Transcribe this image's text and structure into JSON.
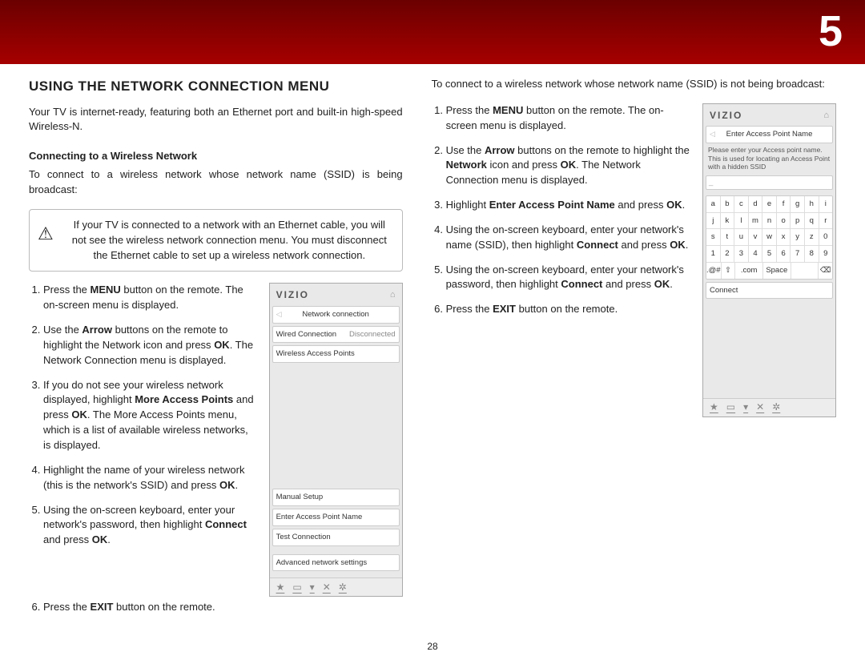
{
  "chapter_number": "5",
  "page_number": "28",
  "section_heading": "USING THE NETWORK CONNECTION MENU",
  "intro": "Your TV is internet-ready, featuring both an Ethernet port and built-in high-speed Wireless-N.",
  "subhead_a": "Connecting to a Wireless Network",
  "lead_a": "To connect to a wireless network whose network name (SSID) is being broadcast:",
  "callout": {
    "icon": "⚠",
    "text": "If your TV is connected to a network with an Ethernet cable, you will not see the wireless network connection menu. You must disconnect the Ethernet cable to set up a wireless network connection."
  },
  "steps_a": [
    {
      "pre": "Press the ",
      "b": "MENU",
      "post": " button on the remote. The on-screen menu is displayed."
    },
    {
      "pre": "Use the ",
      "b": "Arrow",
      "mid": " buttons on the remote to highlight the Network icon and press ",
      "b2": "OK",
      "post": ". The Network Connection menu is displayed."
    },
    {
      "pre": "If you do not see your wireless network displayed, highlight ",
      "b": "More Access Points",
      "mid": " and press ",
      "b2": "OK",
      "post": ". The More Access Points menu, which is a list of available wireless networks, is displayed."
    },
    {
      "pre": "Highlight the name of your wireless network (this is the network's SSID) and press ",
      "b": "OK",
      "post": "."
    },
    {
      "pre": "Using the on-screen keyboard, enter your network's password, then highlight ",
      "b": "Connect",
      "mid": " and press ",
      "b2": "OK",
      "post": "."
    },
    {
      "pre": "Press the ",
      "b": "EXIT",
      "post": " button on the remote."
    }
  ],
  "panel_a": {
    "brand": "VIZIO",
    "home_icon": "⌂",
    "crumb": "Network connection",
    "back_icon": "◁",
    "rows": [
      {
        "label": "Wired Connection",
        "value": "Disconnected"
      },
      {
        "label": "Wireless Access Points",
        "value": ""
      }
    ],
    "options": [
      "Manual Setup",
      "Enter Access Point Name",
      "Test Connection"
    ],
    "advanced": "Advanced network settings",
    "foot_icons": [
      "★",
      "▭",
      "▾",
      "✕",
      "✲"
    ]
  },
  "lead_b": "To connect to a wireless network whose network name (SSID) is not being broadcast:",
  "steps_b": [
    {
      "pre": "Press the ",
      "b": "MENU",
      "post": " button on the remote. The on-screen menu is displayed."
    },
    {
      "pre": "Use the ",
      "b": "Arrow",
      "mid": " buttons on the remote to highlight the ",
      "b2": "Network",
      "mid2": " icon and press ",
      "b3": "OK",
      "post": ". The Network Connection menu is displayed."
    },
    {
      "pre": "Highlight ",
      "b": "Enter Access Point Name",
      "mid": " and press ",
      "b2": "OK",
      "post": "."
    },
    {
      "pre": "Using the on-screen keyboard, enter your network's name (SSID), then highlight ",
      "b": "Connect",
      "mid": " and press ",
      "b2": "OK",
      "post": "."
    },
    {
      "pre": "Using the on-screen keyboard, enter your network's password, then highlight ",
      "b": "Connect",
      "mid": " and press ",
      "b2": "OK",
      "post": "."
    },
    {
      "pre": "Press the ",
      "b": "EXIT",
      "post": " button on the remote."
    }
  ],
  "panel_b": {
    "brand": "VIZIO",
    "home_icon": "⌂",
    "crumb": "Enter Access Point Name",
    "back_icon": "◁",
    "desc": "Please enter your Access point name. This is used for locating an Access Point with a hidden SSID",
    "caret": "_",
    "keyboard": [
      [
        "a",
        "b",
        "c",
        "d",
        "e",
        "f",
        "g",
        "h",
        "i"
      ],
      [
        "j",
        "k",
        "l",
        "m",
        "n",
        "o",
        "p",
        "q",
        "r"
      ],
      [
        "s",
        "t",
        "u",
        "v",
        "w",
        "x",
        "y",
        "z",
        "0"
      ],
      [
        "1",
        "2",
        "3",
        "4",
        "5",
        "6",
        "7",
        "8",
        "9"
      ]
    ],
    "special_row": {
      "sym": ".@#",
      "shift": "⇧",
      "com": ".com",
      "space": "Space",
      "del": "⌫"
    },
    "connect": "Connect",
    "foot_icons": [
      "★",
      "▭",
      "▾",
      "✕",
      "✲"
    ]
  }
}
